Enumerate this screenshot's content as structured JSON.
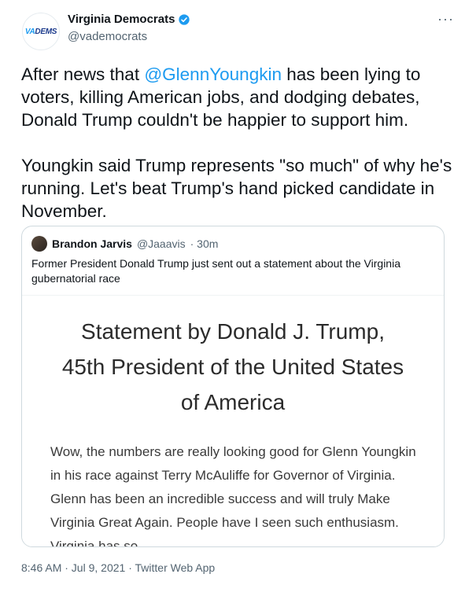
{
  "author": {
    "avatar_text": "VADEMS",
    "name": "Virginia Democrats",
    "handle": "@vademocrats",
    "more_label": "···"
  },
  "tweet": {
    "text_part1": "After news that ",
    "mention": "@GlennYoungkin",
    "text_part2": " has been lying to voters, killing American jobs, and dodging debates, Donald Trump couldn't be happier to support him.\n\nYoungkin said Trump represents \"so much\" of why he's running. Let's beat Trump's hand picked candidate in November."
  },
  "quote": {
    "name": "Brandon Jarvis",
    "handle": "@Jaaavis",
    "time": "· 30m",
    "text": "Former President Donald Trump just sent out a statement about the Virginia gubernatorial race",
    "image": {
      "title_line1": "Statement by Donald J. Trump,",
      "title_line2": "45th President of the United States",
      "title_line3": "of America",
      "body": "Wow, the numbers are really looking good for Glenn Youngkin in his race against Terry McAuliffe for Governor of Virginia. Glenn has been an incredible success and will truly Make Virginia Great Again. People have I seen such enthusiasm. Virginia has so"
    }
  },
  "footer": {
    "timestamp": "8:46 AM · Jul 9, 2021 · ",
    "source": "Twitter Web App"
  },
  "colors": {
    "accent": "#1d9bf0",
    "text": "#0f1419",
    "muted": "#536471"
  }
}
